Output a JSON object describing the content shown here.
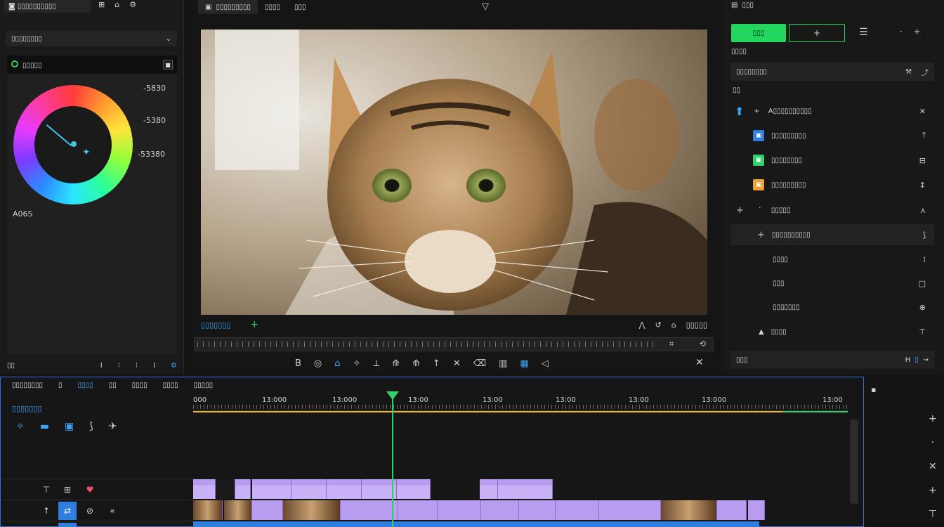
{
  "left": {
    "top_tab": "◙ ▯▯▯▯▯▯▯▯▯▯",
    "top_icons": [
      "⊞",
      "⌂",
      "⚙"
    ],
    "dropdown_label": "▯▯▯▯▯▯▯▯",
    "sub_label": "▯▯▯▯▯",
    "wheel_values": [
      "-5830",
      "-5380",
      "-53380"
    ],
    "wheel_label": "A06S",
    "bottom_left": "▯▯",
    "bottom_icons": [
      "I",
      "⁝",
      "⁝",
      "I"
    ]
  },
  "viewer": {
    "tab_title": "▯▯▯▯▯▯▯▯▯",
    "tab_2": "▯▯▯▯",
    "tab_3": "▯▯▯",
    "timecode": "▯▯▯▯▯▯▯",
    "right_controls": "▯▯▯▯▯",
    "tools": [
      "B",
      "◎",
      "⌂",
      "✧",
      "⟂",
      "⟰",
      "⟰",
      "↑",
      "✕",
      "⌫",
      "▥",
      "▦",
      "◁"
    ],
    "close": "✕"
  },
  "right": {
    "title": "▯▯▯",
    "green_btn": "▯▯▯",
    "outline_btn": "+",
    "section": "▯▯▯▯",
    "search": "▯▯▯▯▯▯▯▯",
    "label": "▯▯",
    "rows": [
      {
        "label": "A▯▯▯▯▯▯▯▯▯▯",
        "trail": "✕"
      },
      {
        "label": "▯▯▯▯▯▯▯▯▯",
        "trail": "⤒"
      },
      {
        "label": "▯▯▯▯▯▯▯▯",
        "trail": "⊟"
      },
      {
        "label": "▯▯▯▯▯▯▯▯▯",
        "trail": "↕"
      },
      {
        "label": "▯▯▯▯▯",
        "trail": "⋏"
      },
      {
        "label": "▯▯▯▯▯▯▯▯▯▯",
        "trail": "⟆"
      },
      {
        "label": "▯▯▯▯",
        "trail": "⁞"
      },
      {
        "label": "▯▯▯",
        "trail": "□"
      },
      {
        "label": "▯▯▯▯▯▯▯",
        "trail": "⊕"
      },
      {
        "label": "▯▯▯▯",
        "trail": "⊤"
      }
    ],
    "footer_left": "▯▯▯",
    "footer_right": "H"
  },
  "timeline": {
    "tabs": [
      "▯▯▯▯▯▯▯▯",
      "▯",
      "▯▯▯▯",
      "▯▯",
      "▯▯▯▯",
      "▯▯▯▯",
      "▯▯▯▯▯"
    ],
    "sequence_name": "▯▯▯▯▯▯▯",
    "ruler_labels": [
      "000",
      "13:000",
      "13:000",
      "13:00",
      "13:00",
      "13:00",
      "13:00",
      "13:000",
      "13:00"
    ]
  },
  "colors": {
    "accent_blue": "#38a8ff",
    "accent_green": "#23d65e",
    "clip_purple": "#b79cf0"
  }
}
